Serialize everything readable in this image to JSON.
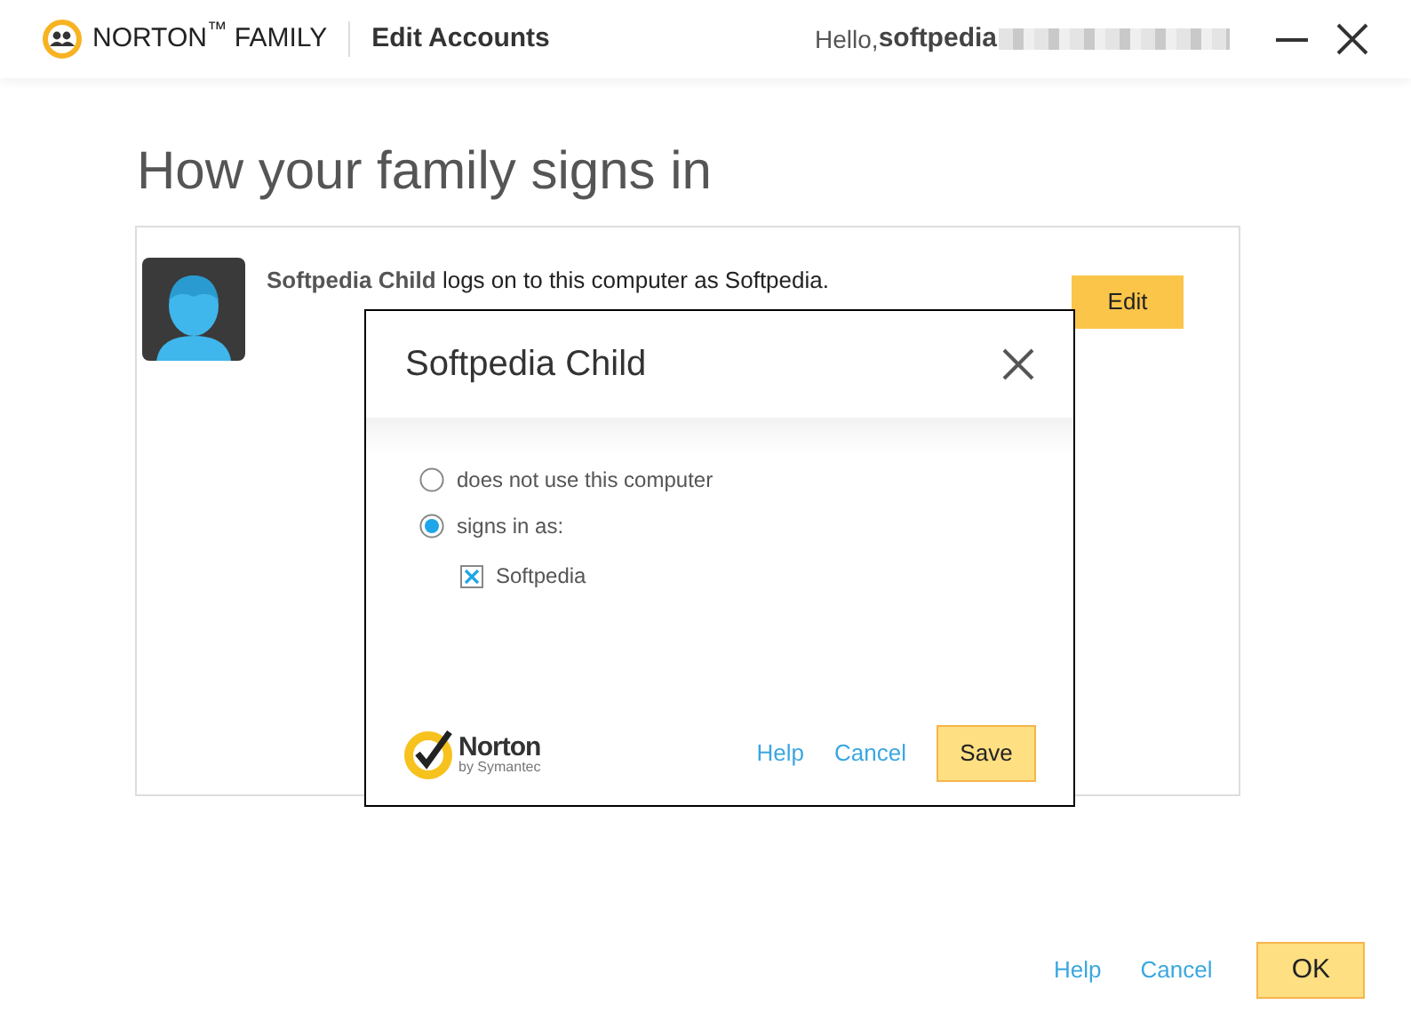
{
  "header": {
    "brand": "NORTON$^{™}$ FAMILY",
    "section": "Edit Accounts",
    "greeting": "Hello,",
    "user": "softpedia"
  },
  "page_title": "How your family signs in",
  "accounts": [
    {
      "name": "Softpedia Child",
      "description": " logs on to this computer as Softpedia.",
      "button": "Edit"
    }
  ],
  "dialog": {
    "title": "Softpedia Child",
    "options": [
      {
        "label": "does not use this computer",
        "selected": false
      },
      {
        "label": "signs in as:",
        "selected": true
      }
    ],
    "users": [
      {
        "label": "Softpedia",
        "checked": true
      }
    ],
    "logo": {
      "name": "Norton",
      "tagline": "by Symantec"
    },
    "links": [
      "Help",
      "Cancel"
    ],
    "save": "Save"
  },
  "footer": {
    "links": [
      "Help",
      "Cancel"
    ],
    "ok": "OK"
  }
}
